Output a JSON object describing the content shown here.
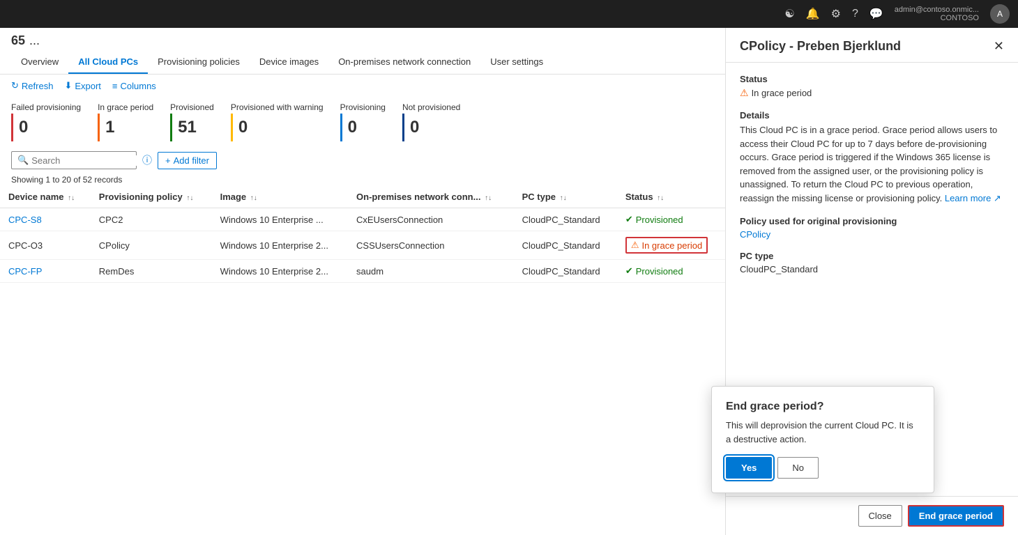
{
  "topbar": {
    "icons": [
      "settings-icon",
      "notifications-icon",
      "gear-icon",
      "help-icon",
      "feedback-icon"
    ],
    "user": {
      "name": "admin@contoso.onmic...",
      "tenant": "CONTOSO",
      "avatar_initial": "A"
    }
  },
  "breadcrumb": {
    "number": "65",
    "dots": "..."
  },
  "nav": {
    "tabs": [
      {
        "id": "overview",
        "label": "Overview"
      },
      {
        "id": "all-cloud-pcs",
        "label": "All Cloud PCs",
        "active": true
      },
      {
        "id": "provisioning-policies",
        "label": "Provisioning policies"
      },
      {
        "id": "device-images",
        "label": "Device images"
      },
      {
        "id": "on-premises",
        "label": "On-premises network connection"
      },
      {
        "id": "user-settings",
        "label": "User settings"
      }
    ]
  },
  "toolbar": {
    "refresh_label": "Refresh",
    "export_label": "Export",
    "columns_label": "Columns"
  },
  "status_cards": [
    {
      "label": "Failed provisioning",
      "value": "0",
      "bar_class": "bar-red"
    },
    {
      "label": "In grace period",
      "value": "1",
      "bar_class": "bar-orange"
    },
    {
      "label": "Provisioned",
      "value": "51",
      "bar_class": "bar-green"
    },
    {
      "label": "Provisioned with warning",
      "value": "0",
      "bar_class": "bar-yellow"
    },
    {
      "label": "Provisioning",
      "value": "0",
      "bar_class": "bar-blue"
    },
    {
      "label": "Not provisioned",
      "value": "0",
      "bar_class": "bar-darkblue"
    }
  ],
  "filter": {
    "search_placeholder": "Search",
    "add_filter_label": "Add filter"
  },
  "records_info": "Showing 1 to 20 of 52 records",
  "table": {
    "columns": [
      {
        "id": "device-name",
        "label": "Device name"
      },
      {
        "id": "provisioning-policy",
        "label": "Provisioning policy"
      },
      {
        "id": "image",
        "label": "Image"
      },
      {
        "id": "on-premises",
        "label": "On-premises network conn..."
      },
      {
        "id": "pc-type",
        "label": "PC type"
      },
      {
        "id": "status",
        "label": "Status"
      }
    ],
    "rows": [
      {
        "device_name": "CPC-S8",
        "is_link": true,
        "provisioning_policy": "CPC2",
        "image": "Windows 10 Enterprise ...",
        "on_premises": "CxEUsersConnection",
        "pc_type": "CloudPC_Standard",
        "status": "Provisioned",
        "status_type": "provisioned"
      },
      {
        "device_name": "CPC-O3",
        "is_link": false,
        "provisioning_policy": "CPolicy",
        "image": "Windows 10 Enterprise 2...",
        "on_premises": "CSSUsersConnection",
        "pc_type": "CloudPC_Standard",
        "status": "In grace period",
        "status_type": "grace"
      },
      {
        "device_name": "CPC-FP",
        "is_link": true,
        "provisioning_policy": "RemDes",
        "image": "Windows 10 Enterprise 2...",
        "on_premises": "saudm",
        "pc_type": "CloudPC_Standard",
        "status": "Provisioned",
        "status_type": "provisioned"
      }
    ]
  },
  "right_panel": {
    "title": "CPolicy - Preben Bjerklund",
    "status_label": "Status",
    "status_value": "In grace period",
    "details_label": "Details",
    "details_text": "This Cloud PC is in a grace period. Grace period allows users to access their Cloud PC for up to 7 days before de-provisioning occurs. Grace period is triggered if the Windows 365 license is removed from the assigned user, or the provisioning policy is unassigned. To return the Cloud PC to previous operation, reassign the missing license or provisioning policy.",
    "learn_more_label": "Learn more",
    "policy_label": "Policy used for original provisioning",
    "policy_value": "CPolicy",
    "pc_type_label": "PC type",
    "pc_type_value": "CloudPC_Standard",
    "close_btn_label": "Close",
    "end_grace_btn_label": "End grace period"
  },
  "dialog": {
    "title": "End grace period?",
    "message": "This will deprovision the current Cloud PC. It is a destructive action.",
    "yes_label": "Yes",
    "no_label": "No"
  }
}
